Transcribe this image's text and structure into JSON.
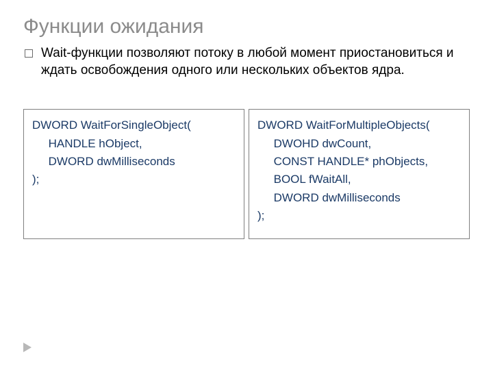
{
  "title": "Функции ожидания",
  "description": "Wait-функции позволяют потоку в любой момент приостановиться и ждать освобождения одного или нескольких объектов ядра.",
  "leftBox": {
    "lines": [
      "DWORD WaitForSingleObject(",
      "     HANDLE hObject,",
      "     DWORD dwMilliseconds",
      ");"
    ]
  },
  "rightBox": {
    "lines": [
      "DWORD WaitForMultipleObjects(",
      "     DWOHD dwCount,",
      "     CONST HANDLE* phObjects,",
      "     BOOL fWaitAll,",
      "     DWORD dwMilliseconds",
      ");"
    ]
  }
}
